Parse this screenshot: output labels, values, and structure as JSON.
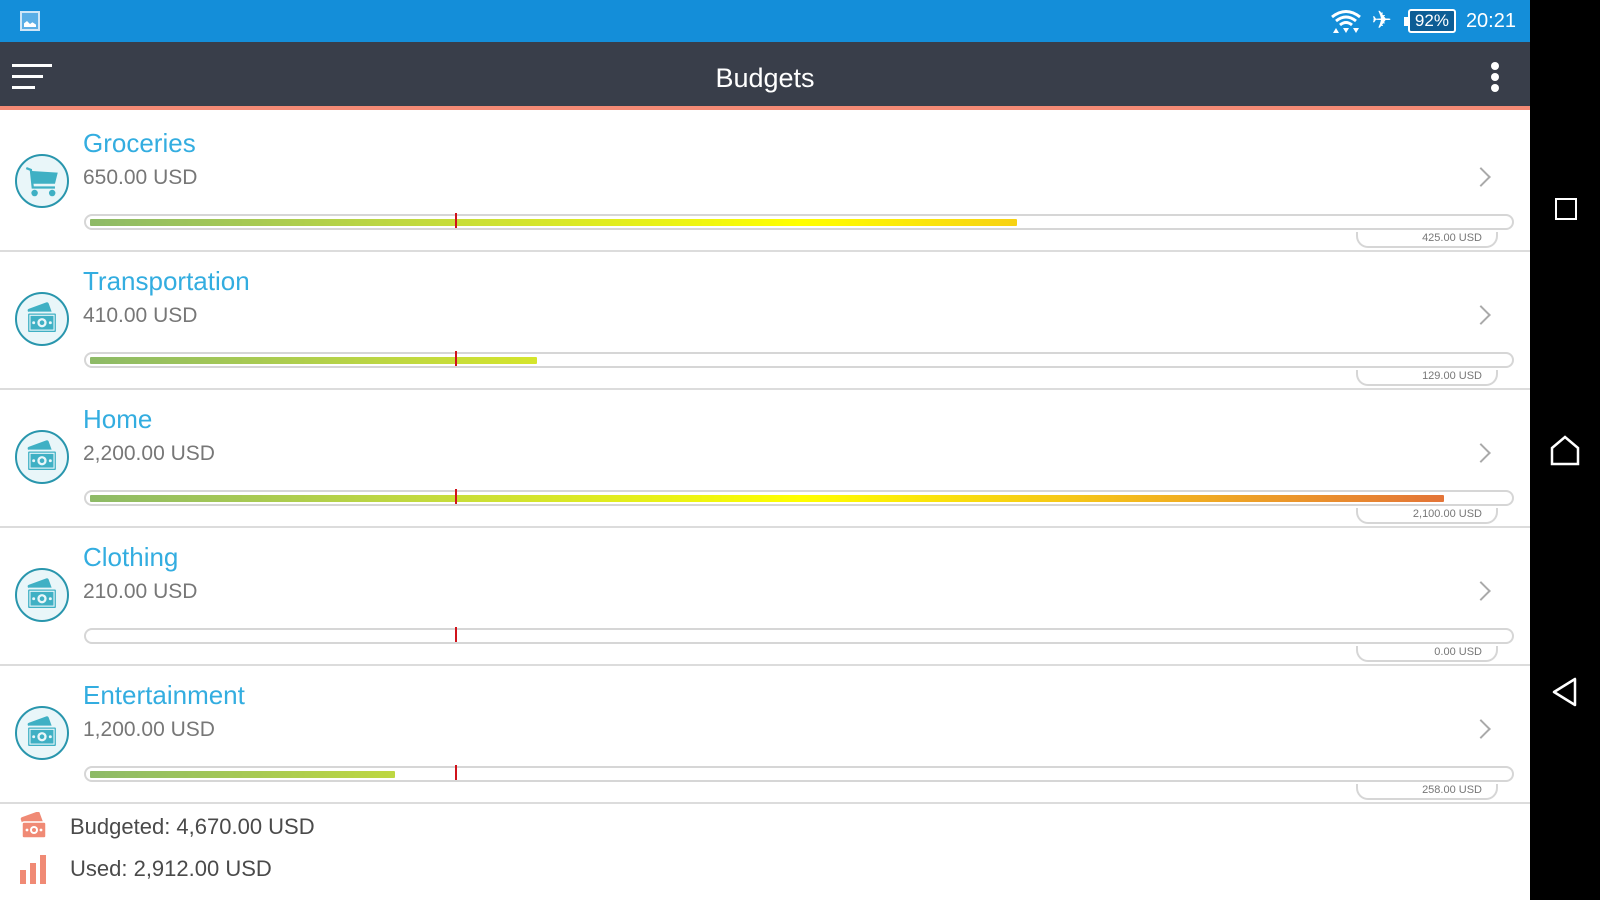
{
  "status_bar": {
    "icons": [
      "gallery-icon",
      "wifi-icon",
      "airplane-mode-icon",
      "battery-icon"
    ],
    "battery": "92%",
    "time": "20:21"
  },
  "toolbar": {
    "title": "Budgets",
    "menu_icon": "hamburger-menu-icon",
    "overflow_icon": "more-vert-icon"
  },
  "colors": {
    "status_bar": "#148ed9",
    "toolbar": "#393e4a",
    "toolbar_accent": "#f48a75",
    "category_name": "#33ade0",
    "icon_teal": "#2996ad",
    "marker": "#d0131b",
    "footer_icon": "#f08a75"
  },
  "period_marker_fraction": 0.26,
  "budgets": [
    {
      "name": "Groceries",
      "budget": "650.00 USD",
      "used": "425.00 USD",
      "used_fraction": 0.654,
      "icon": "shopping-cart-icon"
    },
    {
      "name": "Transportation",
      "budget": "410.00 USD",
      "used": "129.00 USD",
      "used_fraction": 0.315,
      "icon": "money-icon"
    },
    {
      "name": "Home",
      "budget": "2,200.00 USD",
      "used": "2,100.00 USD",
      "used_fraction": 0.955,
      "icon": "money-icon"
    },
    {
      "name": "Clothing",
      "budget": "210.00 USD",
      "used": "0.00 USD",
      "used_fraction": 0.0,
      "icon": "money-icon"
    },
    {
      "name": "Entertainment",
      "budget": "1,200.00 USD",
      "used": "258.00 USD",
      "used_fraction": 0.215,
      "icon": "money-icon"
    }
  ],
  "footer": {
    "budgeted": "Budgeted: 4,670.00 USD",
    "used": "Used: 2,912.00 USD"
  },
  "nav_bar": {
    "buttons": [
      "recent-apps-icon",
      "home-icon",
      "back-icon"
    ]
  }
}
